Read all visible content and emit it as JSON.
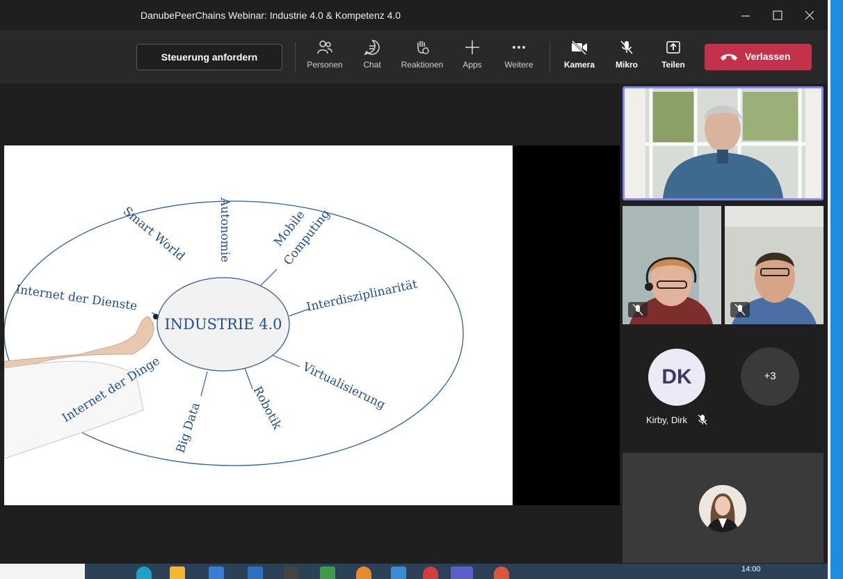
{
  "window": {
    "title": "DanubePeerChains Webinar: Industrie 4.0 & Kompetenz 4.0"
  },
  "toolbar": {
    "request_control": "Steuerung anfordern",
    "people": "Personen",
    "chat": "Chat",
    "reactions": "Reaktionen",
    "apps": "Apps",
    "more": "Weitere",
    "camera": "Kamera",
    "mic": "Mikro",
    "share": "Teilen",
    "leave": "Verlassen"
  },
  "slide": {
    "center": "INDUSTRIE 4.0",
    "spokes": [
      "Smart World",
      "Autonomie",
      "Mobile",
      "Computing",
      "Interdisziplinarität",
      "Virtualisierung",
      "Robotik",
      "Big Data",
      "Internet der Dinge",
      "Internet der Dienste"
    ]
  },
  "participants": {
    "dk_initials": "DK",
    "dk_name": "Kirby, Dirk",
    "overflow": "+3"
  },
  "taskbar": {
    "time": "14:00"
  },
  "colors": {
    "leave": "#c4314b",
    "active_speaker": "#7f85f5",
    "accent": "#1e8de0",
    "slide_ink": "#1f4e8c"
  }
}
